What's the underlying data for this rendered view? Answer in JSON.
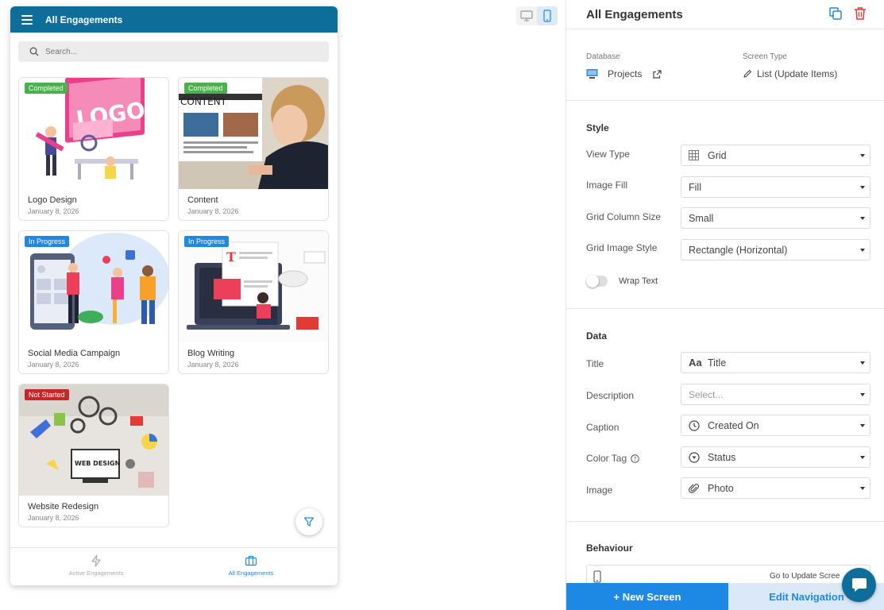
{
  "phone": {
    "header_title": "All Engagements",
    "search_placeholder": "Search...",
    "cards": [
      {
        "title": "Logo Design",
        "date": "January 8, 2026",
        "status": "Completed",
        "status_color": "#4caf50"
      },
      {
        "title": "Content",
        "date": "January 8, 2026",
        "status": "Completed",
        "status_color": "#4caf50"
      },
      {
        "title": "Social Media Campaign",
        "date": "January 8, 2026",
        "status": "In Progress",
        "status_color": "#1e88e5"
      },
      {
        "title": "Blog Writing",
        "date": "January 8, 2026",
        "status": "In Progress",
        "status_color": "#1e88e5"
      },
      {
        "title": "Website Redesign",
        "date": "January 8, 2026",
        "status": "Not Started",
        "status_color": "#c62828"
      }
    ],
    "nav": [
      {
        "label": "Active Engagements",
        "icon": "lightning-icon",
        "active": false
      },
      {
        "label": "All Engagements",
        "icon": "briefcase-icon",
        "active": true
      }
    ]
  },
  "panel": {
    "title": "All Engagements",
    "database_label": "Database",
    "database_value": "Projects",
    "screen_type_label": "Screen Type",
    "screen_type_value": "List (Update Items)",
    "style_heading": "Style",
    "style_rows": [
      {
        "label": "View Type",
        "value": "Grid",
        "icon": "grid-icon"
      },
      {
        "label": "Image Fill",
        "value": "Fill",
        "icon": ""
      },
      {
        "label": "Grid Column Size",
        "value": "Small",
        "icon": ""
      },
      {
        "label": "Grid Image Style",
        "value": "Rectangle (Horizontal)",
        "icon": ""
      }
    ],
    "wrap_text_label": "Wrap Text",
    "data_heading": "Data",
    "data_rows": [
      {
        "label": "Title",
        "value": "Title",
        "icon": "text-icon"
      },
      {
        "label": "Description",
        "value": "Select...",
        "icon": ""
      },
      {
        "label": "Caption",
        "value": "Created On",
        "icon": "clock-icon"
      },
      {
        "label": "Color Tag",
        "value": "Status",
        "icon": "dropdown-circle-icon"
      },
      {
        "label": "Image",
        "value": "Photo",
        "icon": "paperclip-icon"
      }
    ],
    "behaviour_heading": "Behaviour",
    "goto_text": "Go to Update Scree",
    "new_screen_label": "+ New Screen",
    "edit_navigation_label": "Edit Navigation"
  },
  "colors": {
    "header_blue": "#0f6e99",
    "accent_blue": "#1e88e5",
    "delete_red": "#e53935"
  }
}
